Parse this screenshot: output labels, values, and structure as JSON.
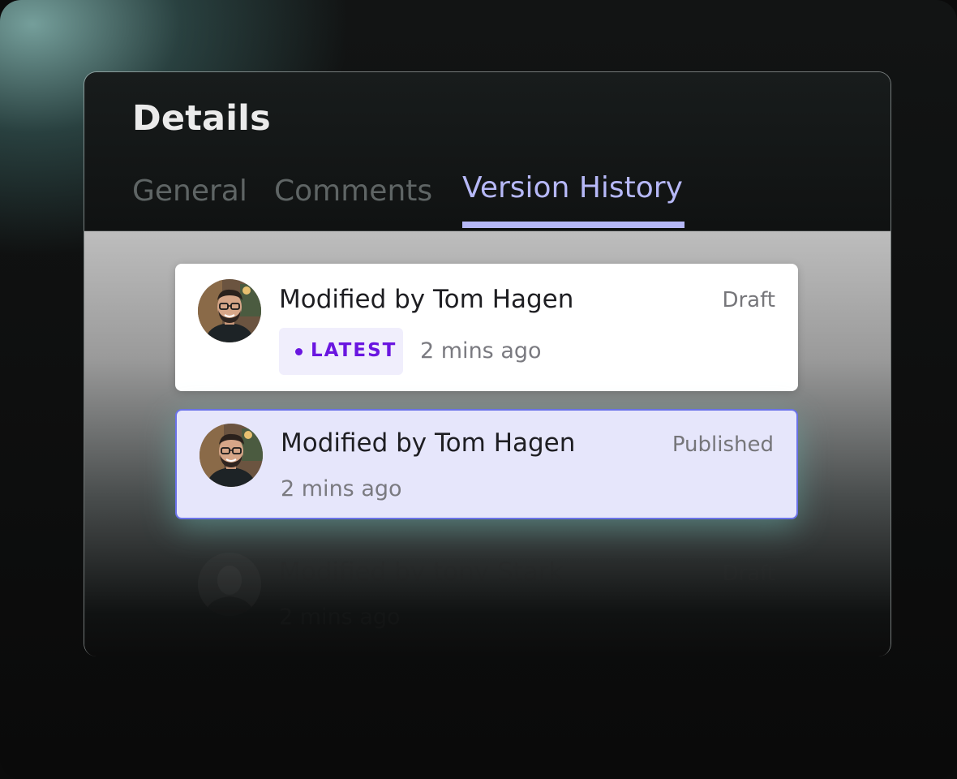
{
  "panel": {
    "title": "Details",
    "tabs": [
      {
        "label": "General",
        "active": false
      },
      {
        "label": "Comments",
        "active": false
      },
      {
        "label": "Version History",
        "active": true
      }
    ],
    "accent_color": "#b6b8f7"
  },
  "versions": [
    {
      "author": "Modified by Tom Hagen",
      "status": "Draft",
      "badge": "LATEST",
      "time": "2 mins ago",
      "selected": false
    },
    {
      "author": "Modified by Tom Hagen",
      "status": "Published",
      "badge": "",
      "time": "2 mins ago",
      "selected": true
    },
    {
      "author": "Modified by tony Stark",
      "status": "Draft",
      "badge": "",
      "time": "2 mins ago",
      "selected": false
    }
  ],
  "colors": {
    "badge_text": "#6a16e0",
    "badge_bg": "#f0eefc",
    "selected_card_bg": "#e6e6fb",
    "selected_card_border": "#6a72e8"
  }
}
